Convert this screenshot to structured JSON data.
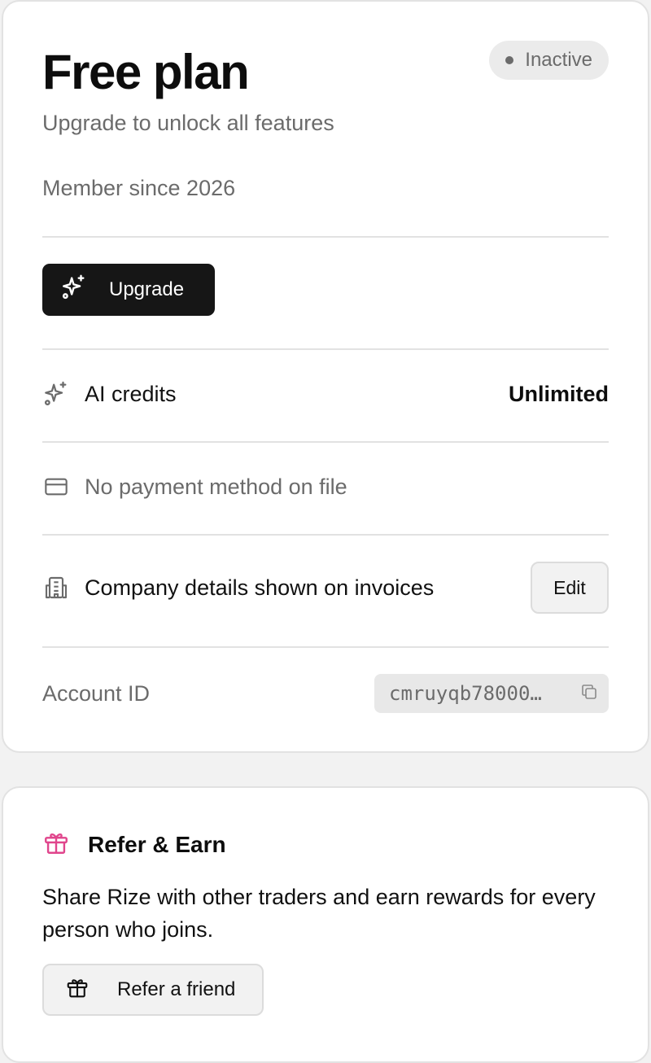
{
  "plan": {
    "title": "Free plan",
    "status": "Inactive",
    "subtitle": "Upgrade to unlock all features",
    "member_since": "Member since 2026",
    "upgrade_label": "Upgrade"
  },
  "details": {
    "ai_credits_label": "AI credits",
    "ai_credits_value": "Unlimited",
    "payment_label": "No payment method on file",
    "company_label": "Company details shown on invoices",
    "edit_label": "Edit",
    "account_id_label": "Account ID",
    "account_id_value": "cmruyqb78000…"
  },
  "refer": {
    "title": "Refer & Earn",
    "description": "Share Rize with other traders and earn rewards for every person who joins.",
    "button_label": "Refer a friend",
    "accent_color": "#e0458c"
  },
  "icons": [
    "sparkles-icon",
    "credit-card-icon",
    "building-icon",
    "copy-icon",
    "gift-icon"
  ]
}
